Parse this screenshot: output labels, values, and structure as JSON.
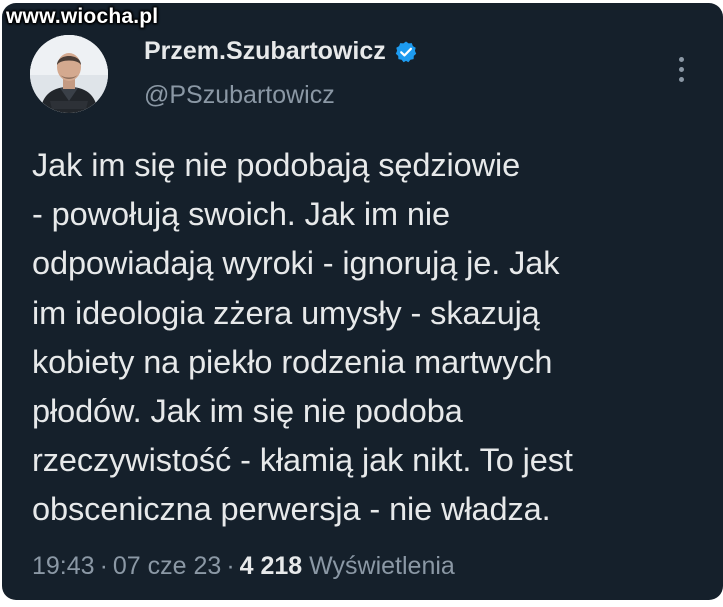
{
  "watermark": "www.wiocha.pl",
  "author": {
    "display_name": "Przem.Szubartowicz",
    "handle": "@PSzubartowicz",
    "verified": true
  },
  "icons": {
    "verified": "verified-badge-icon",
    "more": "more-vertical-icon",
    "avatar": "profile-photo"
  },
  "tweet": {
    "lines": [
      "Jak im się nie podobają sędziowie",
      "- powołują swoich. Jak im nie",
      "odpowiadają wyroki - ignorują je. Jak",
      "im ideologia zżera umysły - skazują",
      "kobiety na piekło rodzenia martwych",
      "płodów. Jak im się nie podoba",
      "rzeczywistość - kłamią jak nikt. To jest",
      "obsceniczna perwersja - nie władza."
    ]
  },
  "meta": {
    "time": "19:43",
    "date": "07 cze 23",
    "separator": "·",
    "views_count": "4 218",
    "views_label": "Wyświetlenia"
  },
  "colors": {
    "background": "#15202b",
    "text": "#e7e9ea",
    "secondary": "#8b98a5",
    "accent": "#1d9bf0"
  }
}
